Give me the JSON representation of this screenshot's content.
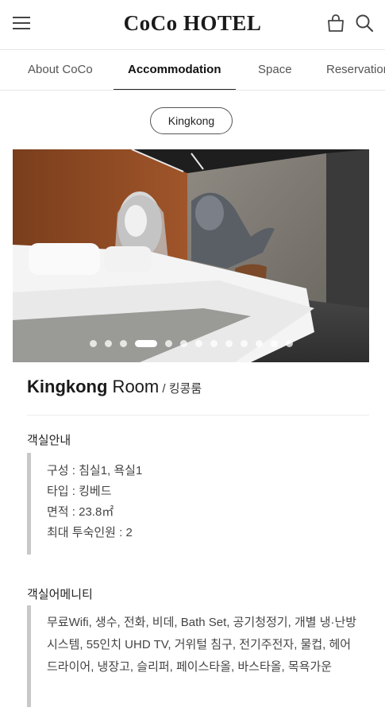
{
  "header": {
    "logo": "CoCo HOTEL",
    "icons": [
      "menu-icon",
      "shopping-bag-icon",
      "search-icon"
    ]
  },
  "nav": {
    "tabs": [
      {
        "label": "About CoCo",
        "active": false
      },
      {
        "label": "Accommodation",
        "active": true
      },
      {
        "label": "Space",
        "active": false
      },
      {
        "label": "Reservation",
        "active": false
      }
    ]
  },
  "room_selector": {
    "label": "Kingkong"
  },
  "gallery": {
    "slide_count": 13,
    "active_index": 3
  },
  "room": {
    "name": "Kingkong",
    "suffix": " Room",
    "korean_name": " / 킹콩룸"
  },
  "room_info": {
    "title": "객실안내",
    "lines": [
      "구성 : 침실1, 욕실1",
      "타입 : 킹베드",
      "면적 : 23.8㎡",
      "최대 투숙인원 : 2"
    ]
  },
  "amenities": {
    "title": "객실어메니티",
    "text": "무료Wifi, 생수, 전화, 비데, Bath Set, 공기청정기, 개별 냉·난방시스템, 55인치 UHD TV, 거위털 침구, 전기주전자, 물컵, 헤어드라이어, 냉장고, 슬리퍼, 페이스타올, 바스타올, 목욕가운"
  },
  "colors": {
    "text": "#222222",
    "accent_bar": "#c8c8c8",
    "divider": "#e6e6e6"
  }
}
